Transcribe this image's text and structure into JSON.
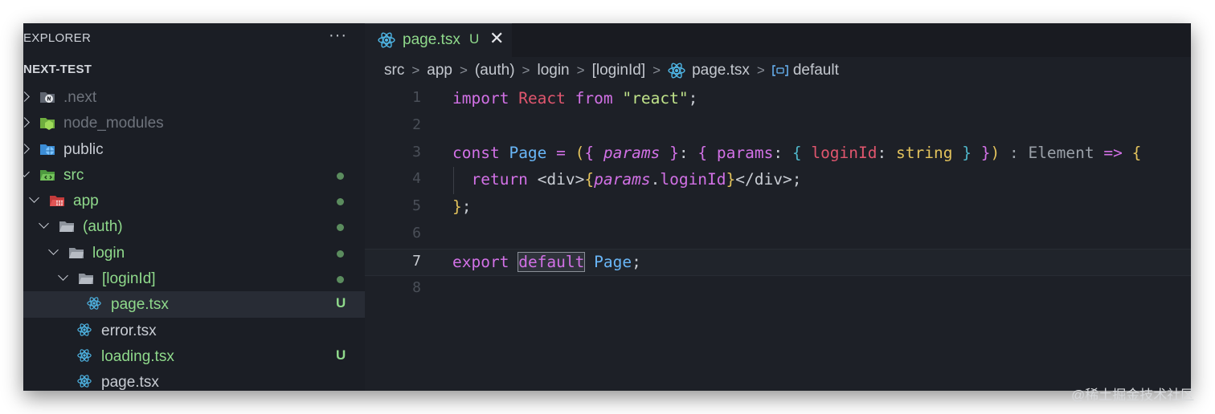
{
  "sidebar": {
    "title": "EXPLORER",
    "more": "···",
    "project": "NEXT-TEST",
    "items": [
      {
        "label": ".next",
        "icon": "next-folder-icon"
      },
      {
        "label": "node_modules",
        "icon": "node-folder-icon"
      },
      {
        "label": "public",
        "icon": "public-folder-icon"
      },
      {
        "label": "src",
        "icon": "src-folder-icon"
      },
      {
        "label": "app",
        "icon": "app-folder-icon"
      },
      {
        "label": "(auth)",
        "icon": "folder-open-icon"
      },
      {
        "label": "login",
        "icon": "folder-open-icon"
      },
      {
        "label": "[loginId]",
        "icon": "folder-open-icon"
      },
      {
        "label": "page.tsx",
        "icon": "react-icon",
        "badge": "U"
      },
      {
        "label": "error.tsx",
        "icon": "react-icon"
      },
      {
        "label": "loading.tsx",
        "icon": "react-icon",
        "badge": "U"
      },
      {
        "label": "page.tsx",
        "icon": "react-icon"
      }
    ]
  },
  "editor": {
    "tab": {
      "name": "page.tsx",
      "status": "U",
      "close": "✕"
    },
    "breadcrumb": [
      "src",
      "app",
      "(auth)",
      "login",
      "[loginId]",
      "page.tsx",
      "default"
    ],
    "line_numbers": [
      "1",
      "2",
      "3",
      "4",
      "5",
      "6",
      "7",
      "8"
    ]
  },
  "colors": {
    "accent_green": "#8fd98b",
    "keyword": "#d271e6",
    "function": "#69b6f7",
    "string": "#c0e38a",
    "react_blue": "#4fb6e6"
  },
  "watermark": "@稀土掘金技术社区"
}
